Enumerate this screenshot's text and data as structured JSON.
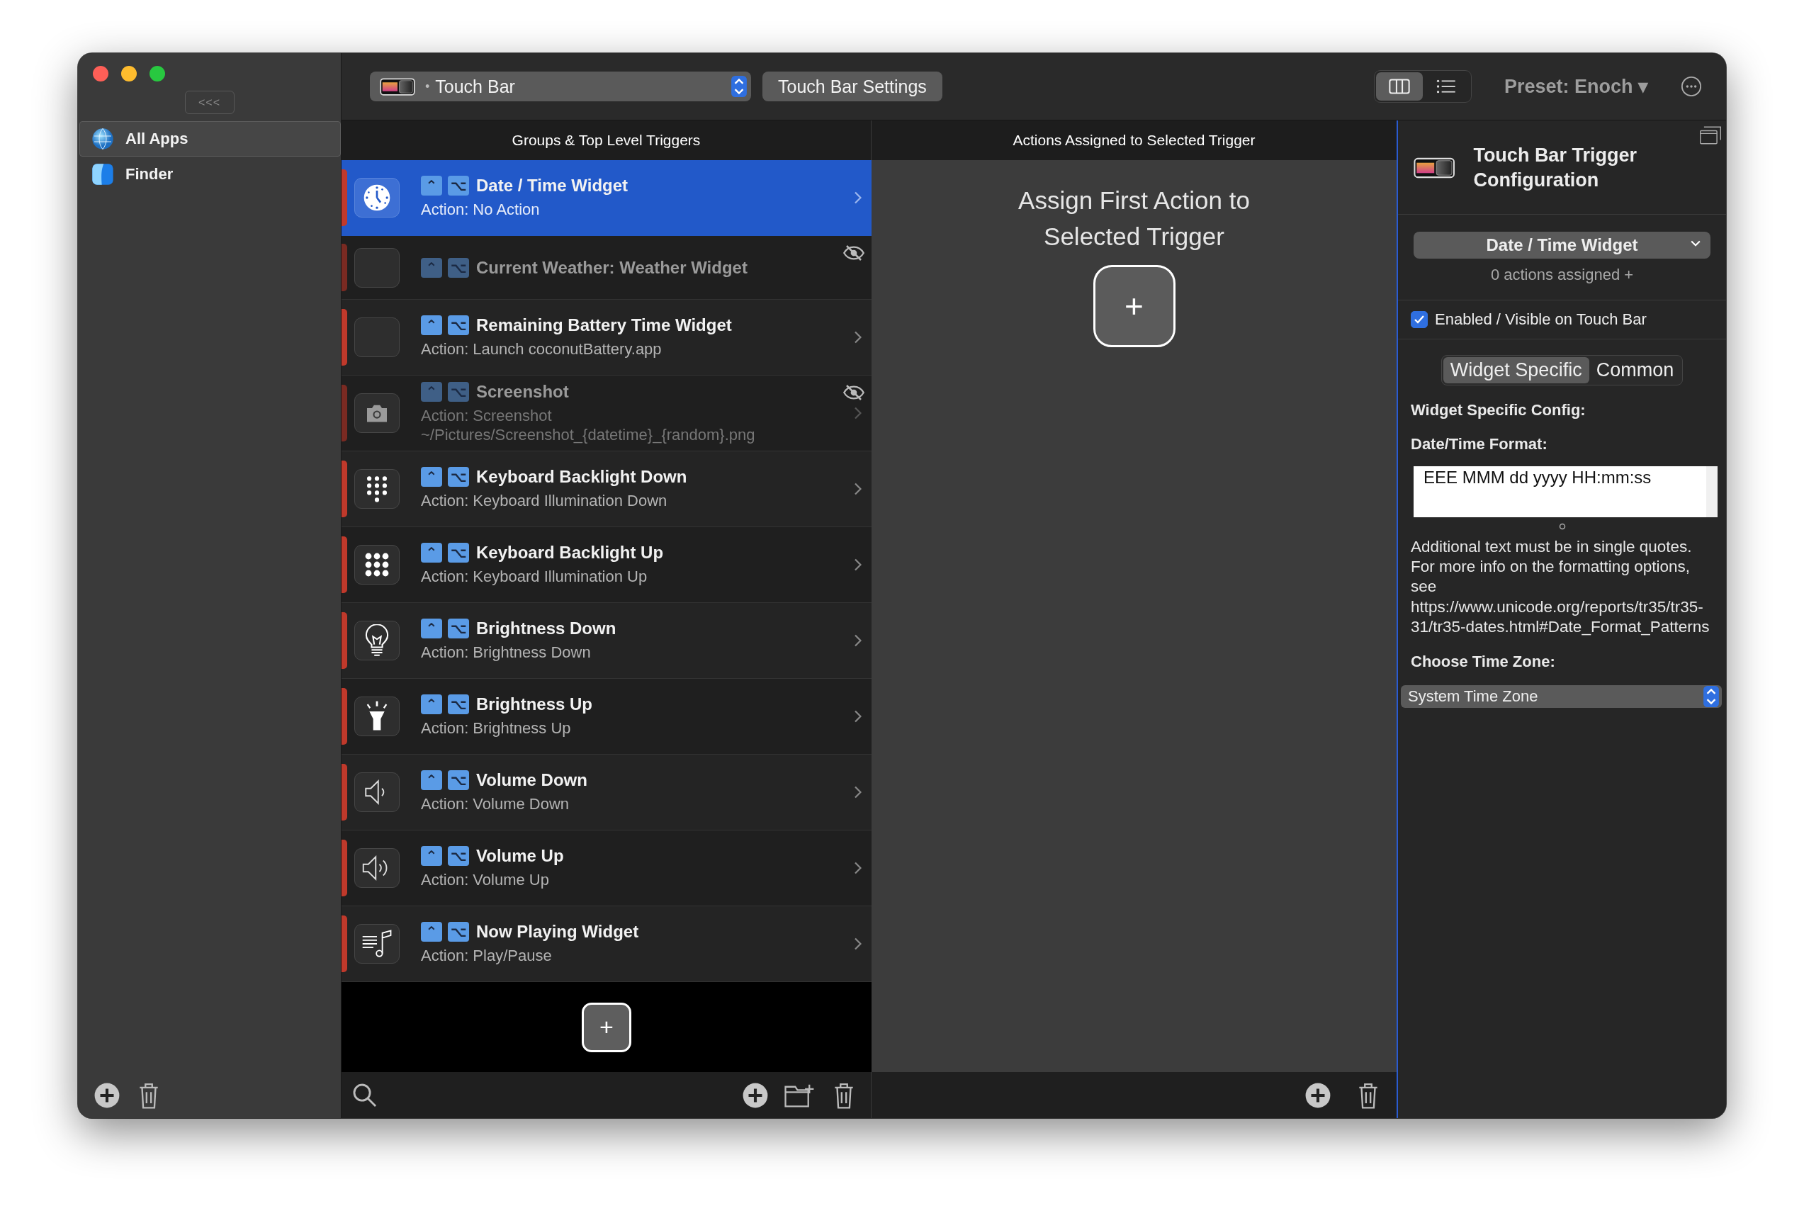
{
  "sidebar": {
    "collapse_button": "<<<",
    "items": [
      {
        "label": "All Apps",
        "kind": "globe",
        "selected": true
      },
      {
        "label": "Finder",
        "kind": "finder",
        "selected": false
      }
    ]
  },
  "toolbar": {
    "device_selector": {
      "bullet": "•",
      "label": "Touch Bar"
    },
    "settings_button": "Touch Bar Settings",
    "view_toggle": [
      {
        "kind": "columns",
        "selected": true
      },
      {
        "kind": "list",
        "selected": false
      }
    ],
    "preset": "Preset: Enoch ▾"
  },
  "triggers": {
    "header": "Groups & Top Level Triggers",
    "add_button": "+",
    "items": [
      {
        "title": "Date / Time Widget",
        "action": "Action: No Action",
        "kind": "clock",
        "modifiers": [
          "⌃",
          "⌥"
        ],
        "selected": true,
        "hidden": false
      },
      {
        "title": "Current Weather: Weather Widget",
        "kind": "blank",
        "modifiers": [
          "⌃",
          "⌥"
        ],
        "selected": false,
        "hidden": true
      },
      {
        "title": "Remaining Battery Time Widget",
        "action": "Action: Launch coconutBattery.app",
        "kind": "blank",
        "modifiers": [
          "⌃",
          "⌥"
        ],
        "selected": false,
        "hidden": false
      },
      {
        "title": "Screenshot",
        "action": "Action: Screenshot ~/Pictures/Screenshot_{datetime}_{random}.png",
        "kind": "camera",
        "modifiers": [
          "⌃",
          "⌥"
        ],
        "selected": false,
        "hidden": true
      },
      {
        "title": "Keyboard Backlight Down",
        "action": "Action: Keyboard Illumination Down",
        "kind": "keypad",
        "modifiers": [
          "⌃",
          "⌥"
        ],
        "selected": false,
        "hidden": false
      },
      {
        "title": "Keyboard Backlight Up",
        "action": "Action: Keyboard Illumination Up",
        "kind": "grid",
        "modifiers": [
          "⌃",
          "⌥"
        ],
        "selected": false,
        "hidden": false
      },
      {
        "title": "Brightness Down",
        "action": "Action: Brightness Down",
        "kind": "bulb",
        "modifiers": [
          "⌃",
          "⌥"
        ],
        "selected": false,
        "hidden": false
      },
      {
        "title": "Brightness Up",
        "action": "Action: Brightness Up",
        "kind": "flashlight",
        "modifiers": [
          "⌃",
          "⌥"
        ],
        "selected": false,
        "hidden": false
      },
      {
        "title": "Volume Down",
        "action": "Action: Volume Down",
        "kind": "speaker",
        "modifiers": [
          "⌃",
          "⌥"
        ],
        "selected": false,
        "hidden": false
      },
      {
        "title": "Volume Up",
        "action": "Action: Volume Up",
        "kind": "loudspeaker",
        "modifiers": [
          "⌃",
          "⌥"
        ],
        "selected": false,
        "hidden": false
      },
      {
        "title": "Now Playing Widget",
        "action": "Action: Play/Pause",
        "kind": "music",
        "modifiers": [
          "⌃",
          "⌥"
        ],
        "selected": false,
        "hidden": false
      }
    ]
  },
  "actions": {
    "header": "Actions Assigned to Selected Trigger",
    "empty_message": "Assign First Action to Selected Trigger",
    "add_button": "+"
  },
  "config": {
    "title": "Touch Bar Trigger Configuration",
    "trigger_select": "Date / Time Widget",
    "actions_count": "0 actions assigned +",
    "enabled": {
      "label": "Enabled / Visible on Touch Bar",
      "checked": true
    },
    "tabs": [
      {
        "label": "Widget Specific",
        "selected": true
      },
      {
        "label": "Common",
        "selected": false
      }
    ],
    "section_title": "Widget Specific Config:",
    "format_label": "Date/Time Format:",
    "format_value": "EEE MMM dd yyyy HH:mm:ss",
    "help_text": "Additional text must be in single quotes. For more info on the formatting options, see https://www.unicode.org/reports/tr35/tr35-31/tr35-dates.html#Date_Format_Patterns",
    "timezone_label": "Choose Time Zone:",
    "timezone_value": "System Time Zone"
  }
}
